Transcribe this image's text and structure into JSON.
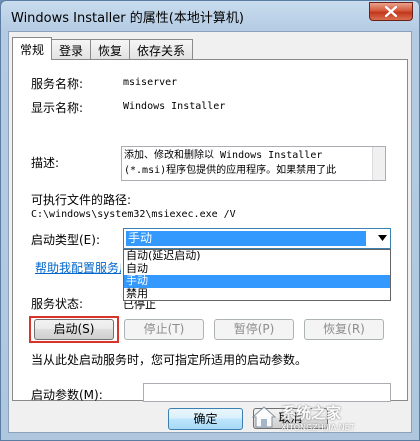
{
  "window": {
    "title": "Windows Installer 的属性(本地计算机)"
  },
  "tabs": [
    {
      "label": "常规",
      "active": true
    },
    {
      "label": "登录",
      "active": false
    },
    {
      "label": "恢复",
      "active": false
    },
    {
      "label": "依存关系",
      "active": false
    }
  ],
  "general": {
    "service_name_label": "服务名称:",
    "service_name_value": "msiserver",
    "display_name_label": "显示名称:",
    "display_name_value": "Windows Installer",
    "description_label": "描述:",
    "description_lines": [
      "添加、修改和删除以 Windows Installer",
      "(*.msi)程序包提供的应用程序。如果禁用了此"
    ],
    "exe_path_label": "可执行文件的路径:",
    "exe_path_value": "C:\\windows\\system32\\msiexec.exe /V",
    "startup_type_label": "启动类型(E):",
    "startup_type_value": "手动",
    "startup_options": [
      {
        "label": "自动(延迟启动)",
        "selected": false
      },
      {
        "label": "自动",
        "selected": false
      },
      {
        "label": "手动",
        "selected": true
      },
      {
        "label": "禁用",
        "selected": false
      }
    ],
    "help_link": "帮助我配置服务启动选项。",
    "service_status_label": "服务状态:",
    "service_status_value": "已停止",
    "buttons": {
      "start": "启动(S)",
      "stop": "停止(T)",
      "pause": "暂停(P)",
      "resume": "恢复(R)"
    },
    "hint": "当从此处启动服务时，您可指定所适用的启动参数。",
    "start_params_label": "启动参数(M):",
    "start_params_value": ""
  },
  "footer": {
    "ok": "确定",
    "cancel": "取消"
  },
  "watermark": {
    "text": "系统之家",
    "sub": "XITONGZHIJIA.NET"
  },
  "colors": {
    "accent": "#3399ff",
    "highlight_border": "#d9342b",
    "link": "#0066cc"
  }
}
